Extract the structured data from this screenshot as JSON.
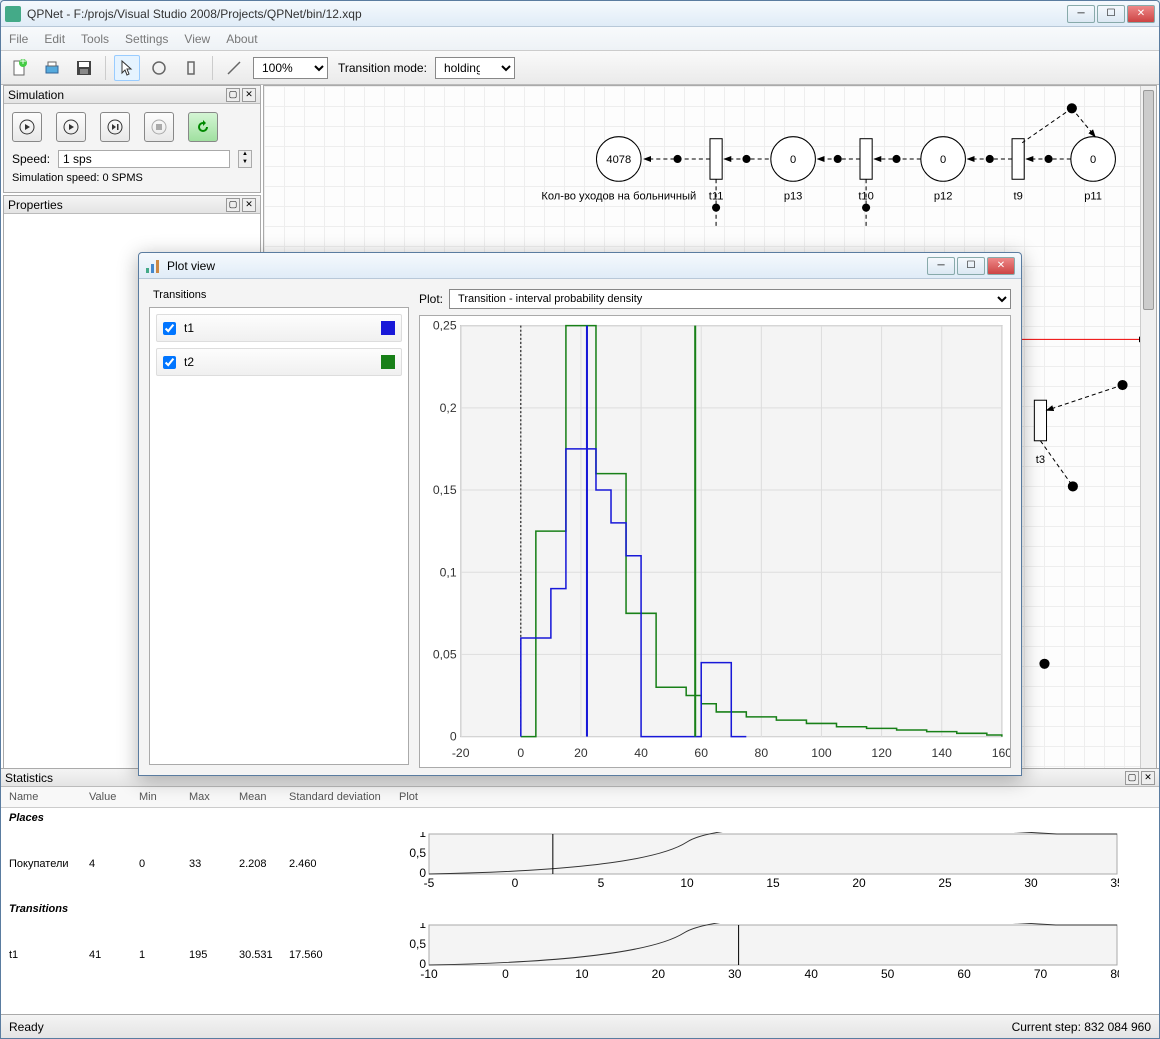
{
  "window": {
    "title": "QPNet - F:/projs/Visual Studio 2008/Projects/QPNet/bin/12.xqp"
  },
  "menu": {
    "file": "File",
    "edit": "Edit",
    "tools": "Tools",
    "settings": "Settings",
    "view": "View",
    "about": "About"
  },
  "toolbar": {
    "zoom": "100%",
    "mode_label": "Transition mode:",
    "mode": "holding"
  },
  "simulation": {
    "title": "Simulation",
    "speed_label": "Speed:",
    "speed_value": "1 sps",
    "status": "Simulation speed: 0 SPMS"
  },
  "properties": {
    "title": "Properties"
  },
  "petri": {
    "p_count_label": "Кол-во уходов на больничный",
    "p_count_value": "4078",
    "p13_label": "p13",
    "p12_label": "p12",
    "p11_label": "p11",
    "t11_label": "t11",
    "t10_label": "t10",
    "t9_label": "t9",
    "t3_label": "t3",
    "zero": "0"
  },
  "plot_window": {
    "title": "Plot view",
    "transitions_label": "Transitions",
    "plot_label": "Plot:",
    "plot_select": "Transition - interval probability density",
    "items": [
      {
        "name": "t1",
        "color": "#1818d8"
      },
      {
        "name": "t2",
        "color": "#188018"
      }
    ]
  },
  "statistics": {
    "title": "Statistics",
    "headers": {
      "name": "Name",
      "value": "Value",
      "min": "Min",
      "max": "Max",
      "mean": "Mean",
      "std": "Standard deviation",
      "plot": "Plot"
    },
    "group_places": "Places",
    "group_trans": "Transitions",
    "rows": [
      {
        "name": "Покупатели",
        "value": "4",
        "min": "0",
        "max": "33",
        "mean": "2.208",
        "std": "2.460"
      },
      {
        "name": "t1",
        "value": "41",
        "min": "1",
        "max": "195",
        "mean": "30.531",
        "std": "17.560"
      }
    ]
  },
  "statusbar": {
    "ready": "Ready",
    "step": "Current step: 832 084 960"
  },
  "chart_data": {
    "type": "bar",
    "title": "",
    "xlabel": "",
    "ylabel": "",
    "xlim": [
      -20,
      160
    ],
    "ylim": [
      0,
      0.25
    ],
    "x_ticks": [
      -20,
      0,
      20,
      40,
      60,
      80,
      100,
      120,
      140,
      160
    ],
    "y_ticks": [
      0,
      0.05,
      0.1,
      0.15,
      0.2,
      0.25
    ],
    "bin_width": 5,
    "series": [
      {
        "name": "t1",
        "color": "#1818d8",
        "x_start": 0,
        "values": [
          0.06,
          0.06,
          0.09,
          0.175,
          0.175,
          0.15,
          0.13,
          0.11,
          0.0,
          0.0,
          0.0,
          0.0,
          0.045,
          0.045,
          0.0
        ]
      },
      {
        "name": "t2",
        "color": "#188018",
        "x_start": 0,
        "values": [
          0.0,
          0.125,
          0.125,
          0.25,
          0.25,
          0.16,
          0.16,
          0.075,
          0.075,
          0.03,
          0.03,
          0.025,
          0.02,
          0.015,
          0.015,
          0.012,
          0.012,
          0.01,
          0.01,
          0.008,
          0.008,
          0.006,
          0.006,
          0.005,
          0.005,
          0.004,
          0.004,
          0.003,
          0.003,
          0.002,
          0.002,
          0.001
        ]
      }
    ],
    "mean_lines": [
      {
        "name": "t1",
        "color": "#1818d8",
        "x": 22
      },
      {
        "name": "t2",
        "color": "#188018",
        "x": 58
      }
    ]
  },
  "stats_mini_charts": [
    {
      "x_ticks": [
        -5,
        0,
        5,
        10,
        15,
        20,
        25,
        30,
        35
      ],
      "y_ticks": [
        0,
        0.5,
        1
      ]
    },
    {
      "x_ticks": [
        -10,
        0,
        10,
        20,
        30,
        40,
        50,
        60,
        70,
        80
      ],
      "y_ticks": [
        0,
        0.5,
        1
      ]
    }
  ]
}
